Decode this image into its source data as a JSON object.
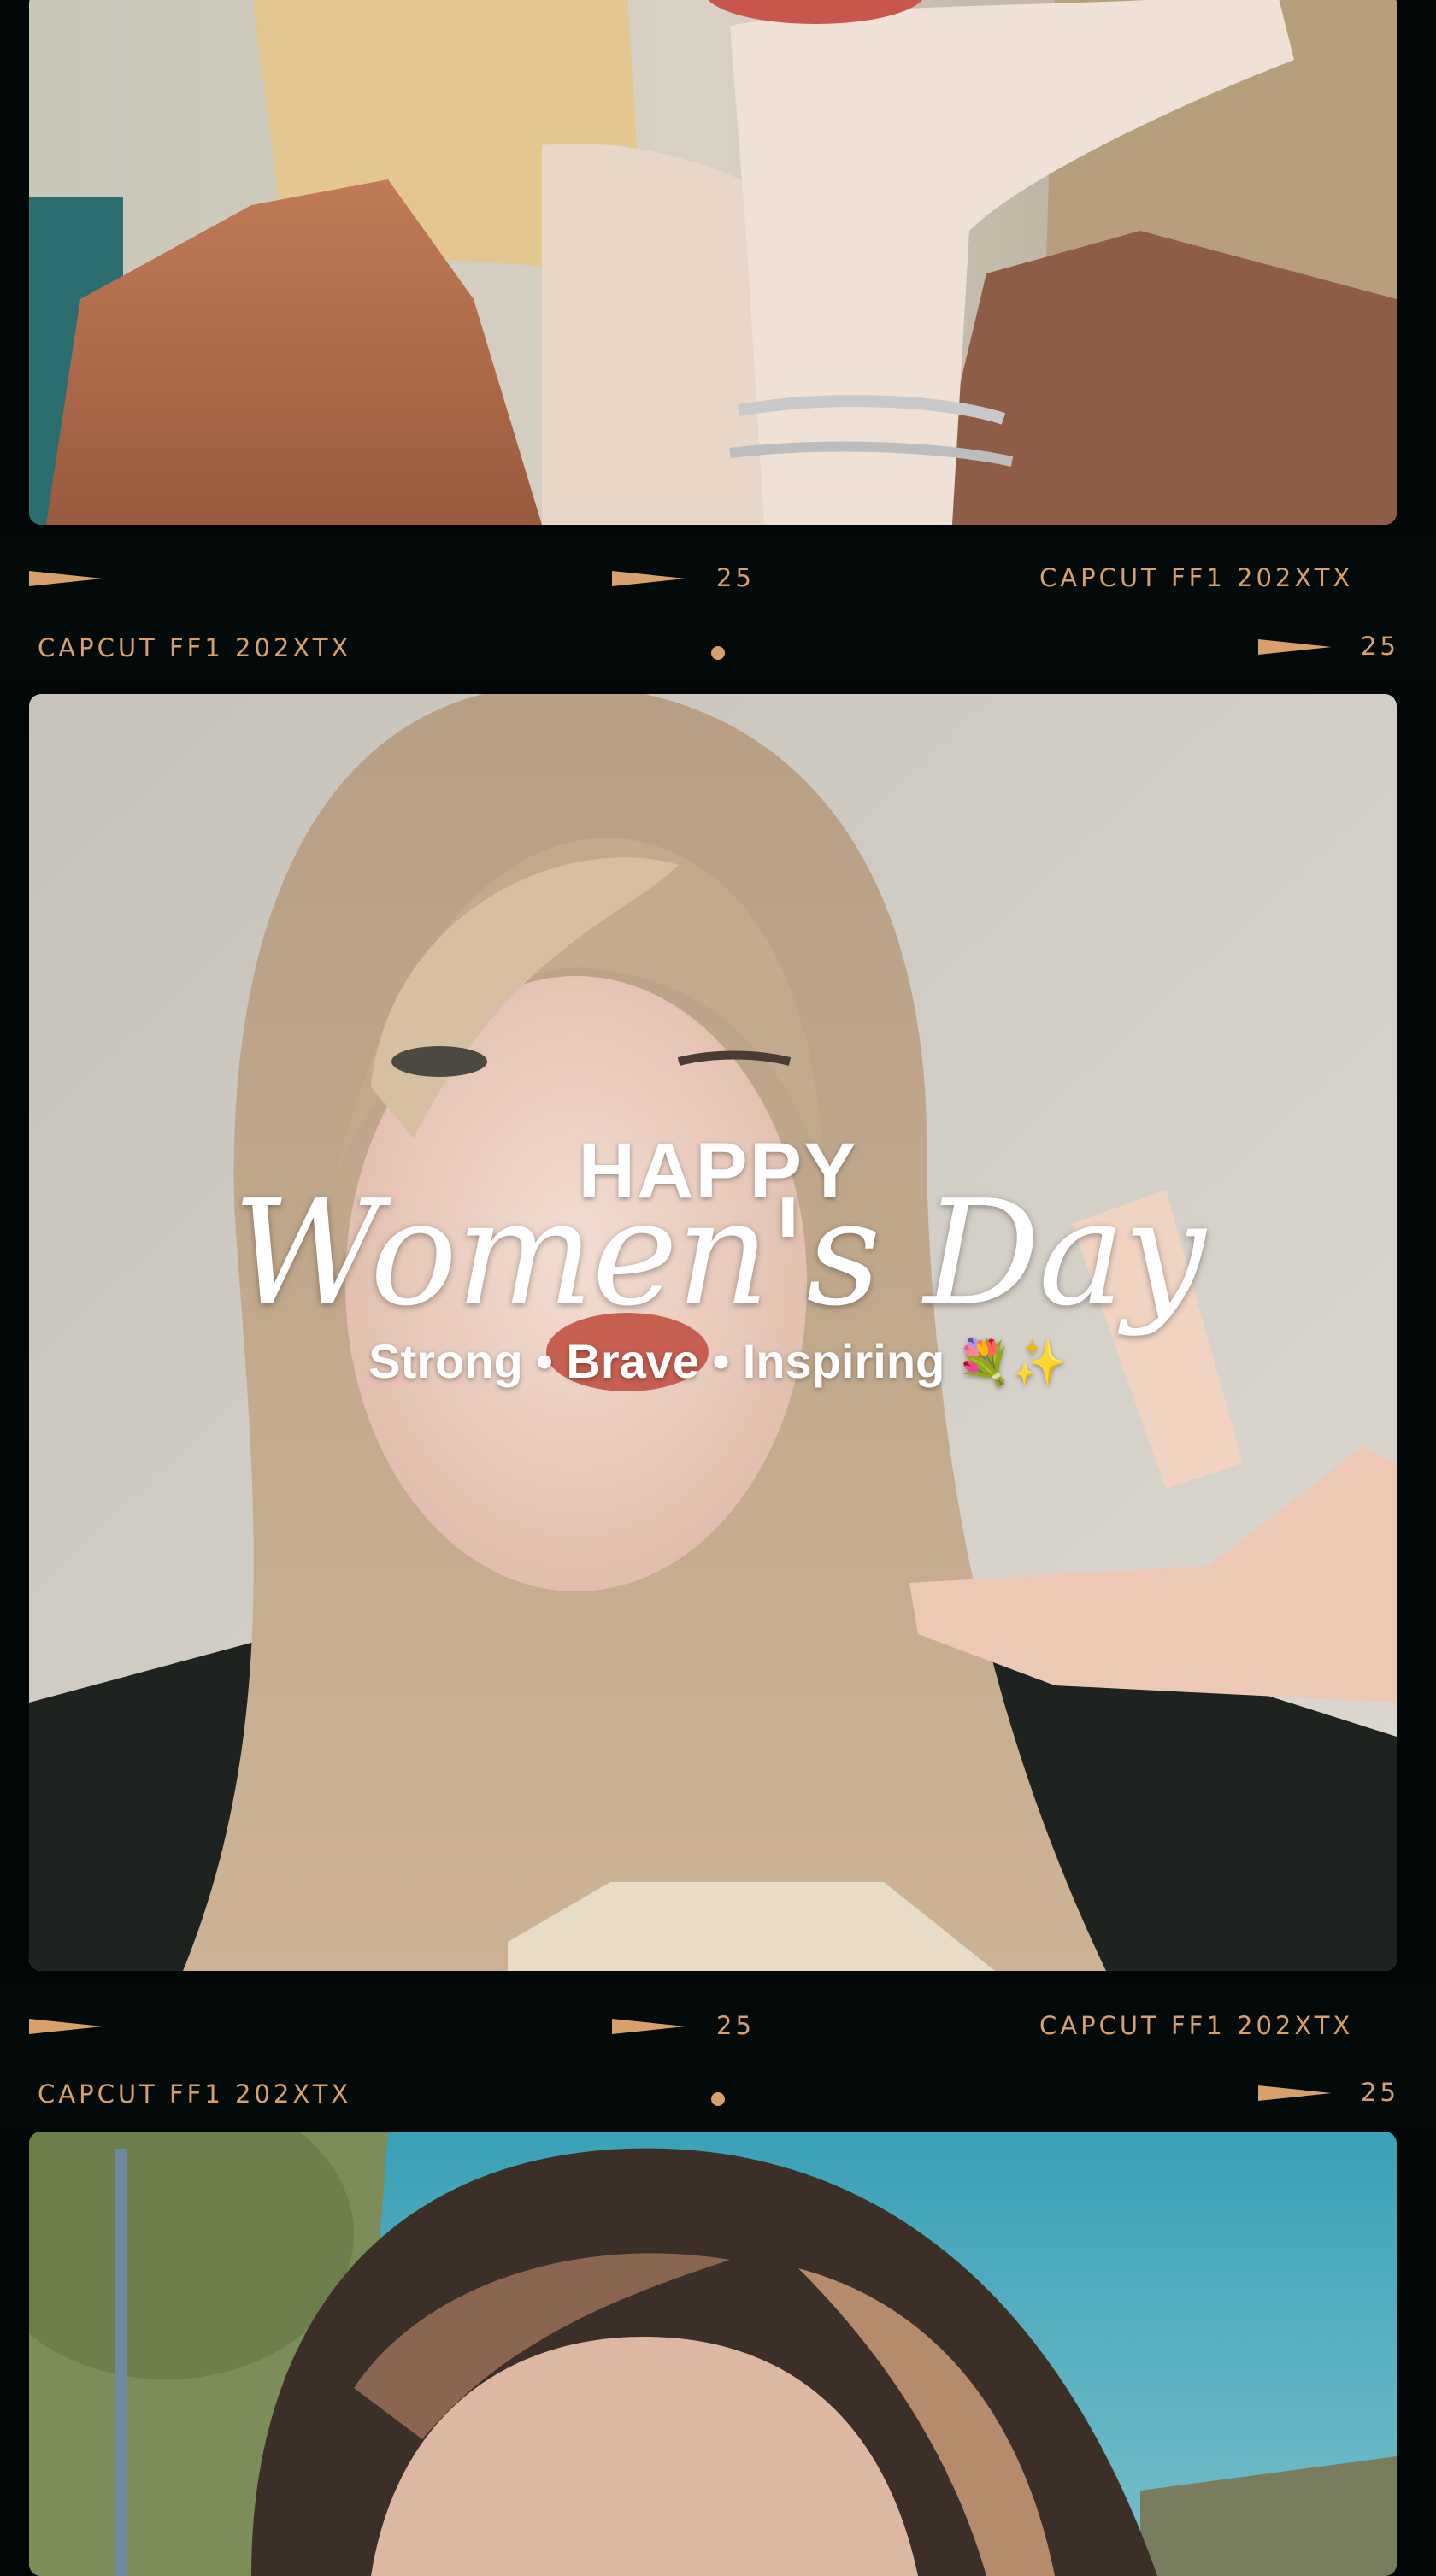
{
  "strip_text": {
    "brand_code": "CAPCUT   FF1 202XTX",
    "frame_number": "25"
  },
  "overlay": {
    "happy": "HAPPY",
    "title": "Women's Day",
    "tagline": "Strong • Brave • Inspiring",
    "emojis": "💐✨"
  },
  "colors": {
    "film_background": "#030708",
    "strip_text": "#d8a06b",
    "overlay_text": "#ffffff"
  }
}
